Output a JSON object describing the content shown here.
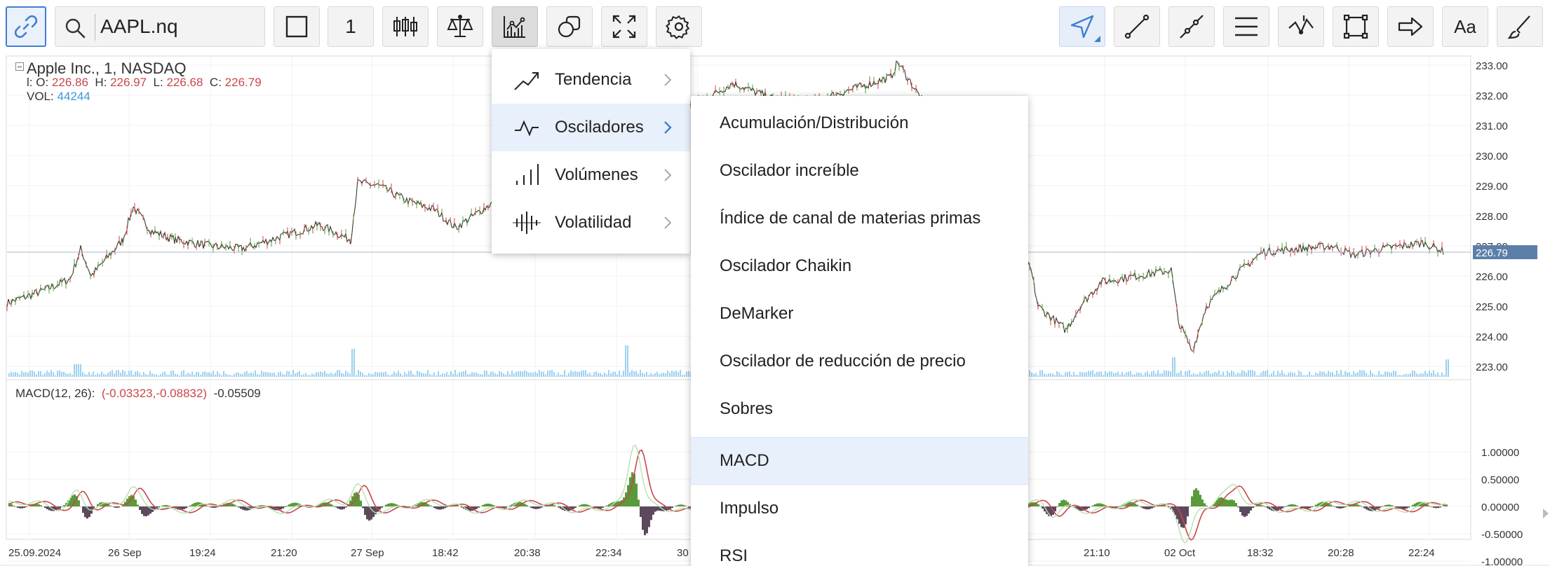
{
  "toolbar": {
    "symbol_value": "AAPL.nq",
    "interval_value": "1",
    "colors": {
      "accent": "#3f7fd1",
      "button_bg": "#f3f3f3"
    }
  },
  "chart": {
    "title": "Apple Inc.,  1,  NASDAQ",
    "ohlc": {
      "o_label": "l: O:",
      "o_value": "226.86",
      "h_label": "H:",
      "h_value": "226.97",
      "l_label": "L:",
      "l_value": "226.68",
      "c_label": "C:",
      "c_value": "226.79"
    },
    "vol_label": "VOL:",
    "vol_value": "44244",
    "last_price_tag": "226.79",
    "price_axis": [
      "233.00",
      "232.00",
      "231.00",
      "230.00",
      "229.00",
      "228.00",
      "227.00",
      "226.00",
      "225.00",
      "224.00",
      "223.00"
    ],
    "macd_axis": [
      "1.00000",
      "0.50000",
      "0.00000",
      "-0.50000",
      "-1.00000"
    ],
    "time_axis": [
      "25.09.2024",
      "26 Sep",
      "19:24",
      "21:20",
      "27 Sep",
      "18:42",
      "20:38",
      "22:34",
      "30",
      "21:10",
      "02 Oct",
      "18:32",
      "20:28",
      "22:24"
    ],
    "macd_legend": {
      "name": "MACD(12, 26):",
      "values": "(-0.03323,-0.08832)",
      "hist": "-0.05509"
    },
    "colors": {
      "up": "#5a9a3a",
      "down": "#c8474c",
      "volume": "#9fd0f0",
      "macd_line": "#5a9a3a",
      "signal_line": "#c8474c",
      "last_tag": "#5b7fa8"
    }
  },
  "indicator_menu": {
    "categories": [
      {
        "label": "Tendencia",
        "icon": "trend-icon"
      },
      {
        "label": "Osciladores",
        "icon": "oscillator-icon"
      },
      {
        "label": "Volúmenes",
        "icon": "volume-bars-icon"
      },
      {
        "label": "Volatilidad",
        "icon": "volatility-icon"
      }
    ],
    "selected_category": "Osciladores",
    "oscillators": [
      "Acumulación/Distribución",
      "Oscilador increíble",
      "Índice de canal de materias primas",
      "Oscilador Chaikin",
      "DeMarker",
      "Oscilador de reducción de precio",
      "Sobres",
      "MACD",
      "Impulso",
      "RSI"
    ],
    "highlighted_item": "MACD"
  }
}
